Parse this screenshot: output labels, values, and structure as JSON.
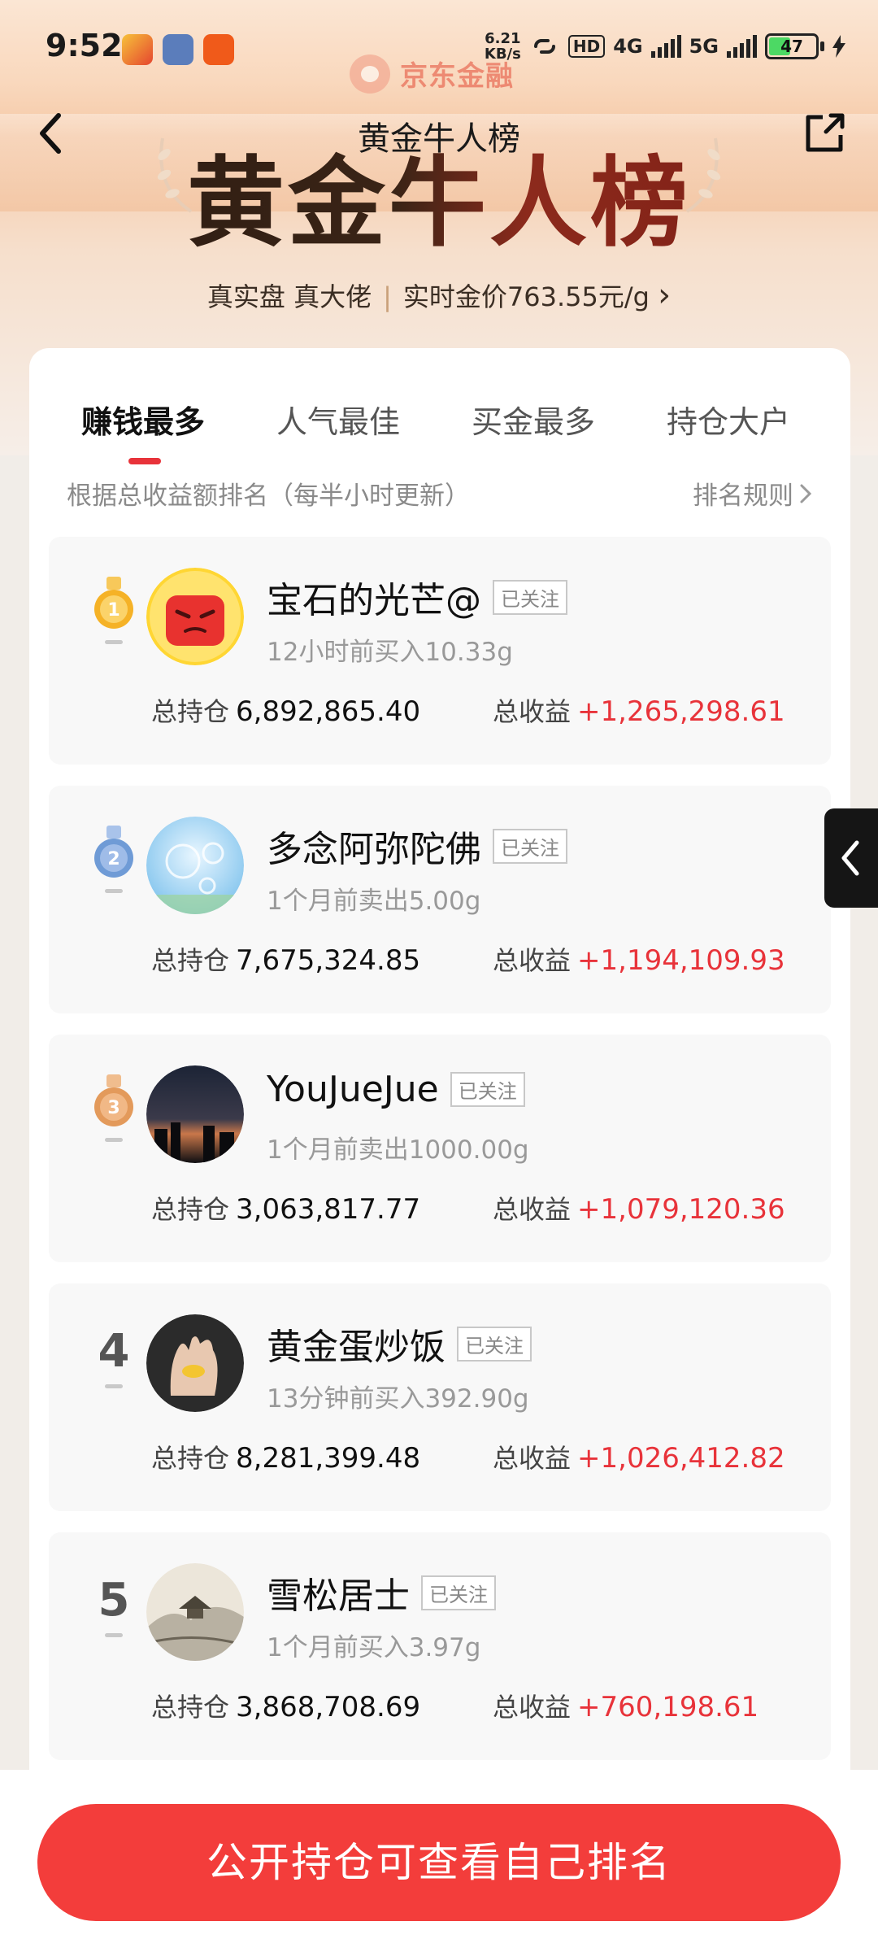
{
  "status_bar": {
    "time": "9:52",
    "net_speed_value": "6.21",
    "net_speed_unit": "KB/s",
    "hd_badge": "HD",
    "network_4g": "4G",
    "network_5g": "5G",
    "battery_level": "47"
  },
  "brand": {
    "name": "京东金融"
  },
  "header": {
    "title": "黄金牛人榜",
    "hero_title": "黄金牛人榜",
    "subtitle_left": "真实盘 真大佬",
    "subtitle_divider": "|",
    "subtitle_right": "实时金价763.55元/g",
    "subtitle_chevron": "›"
  },
  "tabs": [
    {
      "label": "赚钱最多",
      "active": true
    },
    {
      "label": "人气最佳",
      "active": false
    },
    {
      "label": "买金最多",
      "active": false
    },
    {
      "label": "持仓大户",
      "active": false
    }
  ],
  "ranking": {
    "description": "根据总收益额排名（每半小时更新）",
    "rule_label": "排名规则",
    "holding_label": "总持仓",
    "profit_label": "总收益",
    "follow_label": "已关注",
    "entries": [
      {
        "rank": "1",
        "name": "宝石的光芒@",
        "activity": "12小时前买入10.33g",
        "holding": "6,892,865.40",
        "profit": "+1,265,298.61",
        "medal": "gold"
      },
      {
        "rank": "2",
        "name": "多念阿弥陀佛",
        "activity": "1个月前卖出5.00g",
        "holding": "7,675,324.85",
        "profit": "+1,194,109.93",
        "medal": "silver"
      },
      {
        "rank": "3",
        "name": "YouJueJue",
        "activity": "1个月前卖出1000.00g",
        "holding": "3,063,817.77",
        "profit": "+1,079,120.36",
        "medal": "bronze"
      },
      {
        "rank": "4",
        "name": "黄金蛋炒饭",
        "activity": "13分钟前买入392.90g",
        "holding": "8,281,399.48",
        "profit": "+1,026,412.82",
        "medal": "none"
      },
      {
        "rank": "5",
        "name": "雪松居士",
        "activity": "1个月前买入3.97g",
        "holding": "3,868,708.69",
        "profit": "+760,198.61",
        "medal": "none"
      }
    ]
  },
  "cta": {
    "label": "公开持仓可查看自己排名"
  },
  "colors": {
    "accent_red": "#e8333a",
    "cta_red": "#f33d3b",
    "gold": "#f5b227",
    "silver": "#6f9bd6",
    "bronze": "#e39a5b"
  }
}
